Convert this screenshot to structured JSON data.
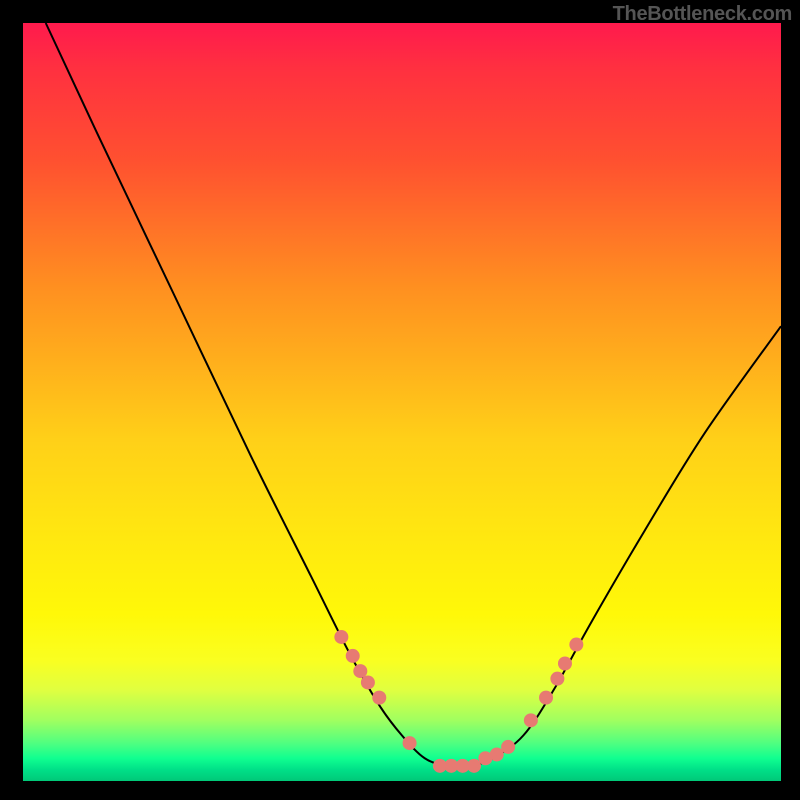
{
  "attribution": "TheBottleneck.com",
  "chart_data": {
    "type": "line",
    "title": "",
    "xlabel": "",
    "ylabel": "",
    "xlim": [
      0,
      100
    ],
    "ylim": [
      0,
      100
    ],
    "grid": false,
    "series": [
      {
        "name": "curve",
        "x": [
          3,
          10,
          20,
          30,
          38,
          43,
          47,
          50,
          53,
          56,
          59,
          62,
          66,
          70,
          75,
          82,
          90,
          100
        ],
        "y": [
          100,
          85,
          64,
          43,
          27,
          17,
          10,
          6,
          3,
          2,
          2,
          3,
          6,
          12,
          21,
          33,
          46,
          60
        ]
      }
    ],
    "markers": {
      "name": "highlight-points",
      "color": "#e77a72",
      "x": [
        42,
        43.5,
        44.5,
        45.5,
        47,
        51,
        55,
        56.5,
        58,
        59.5,
        61,
        62.5,
        64,
        67,
        69,
        70.5,
        71.5,
        73
      ],
      "y": [
        19,
        16.5,
        14.5,
        13,
        11,
        5,
        2,
        2,
        2,
        2,
        3,
        3.5,
        4.5,
        8,
        11,
        13.5,
        15.5,
        18
      ]
    }
  }
}
